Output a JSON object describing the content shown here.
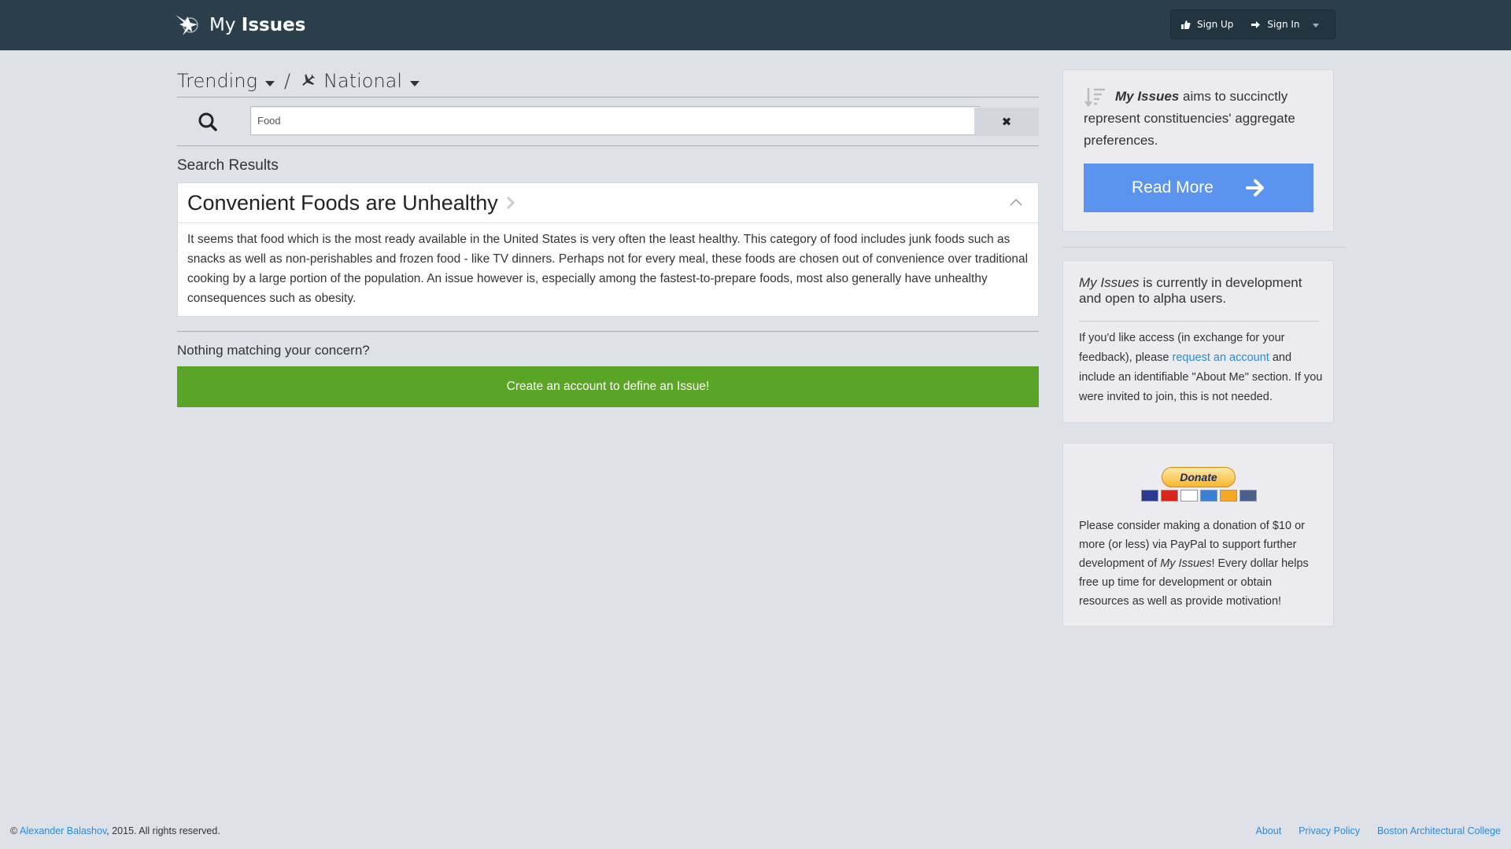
{
  "header": {
    "brand_my": "My",
    "brand_issues": "Issues",
    "sign_up": "Sign Up",
    "sign_in": "Sign In"
  },
  "breadcrumb": {
    "trending": "Trending",
    "separator": "/",
    "national": "National"
  },
  "search": {
    "value": "Food",
    "clear": "✖"
  },
  "results": {
    "label": "Search Results",
    "items": [
      {
        "title": "Convenient Foods are Unhealthy",
        "body": "It seems that food which is the most ready available in the United States is very often the least healthy. This category of food includes junk foods such as snacks as well as non-perishables and frozen food - like TV dinners. Perhaps not for every meal, these foods are chosen out of convenience over traditional cooking by a large portion of the population. An issue however is, especially among the fastest-to-prepare foods, most also generally have unhealthy consequences such as obesity."
      }
    ]
  },
  "cta": {
    "concern": "Nothing matching your concern?",
    "create": "Create an account to define an Issue!"
  },
  "sidebar": {
    "aims_brand": "My Issues",
    "aims_text": " aims to succinctly represent constituencies' aggregate preferences.",
    "read_more": "Read More",
    "dev_brand": "My Issues",
    "dev_text": " is currently in development and open to alpha users.",
    "access_pre": "If you'd like access (in exchange for your feedback), please ",
    "access_link": "request an account",
    "access_post": " and include an identifiable \"About Me\" section. If you were invited to join, this is not needed.",
    "donate": "Donate",
    "donation_pre": "Please consider making a donation of $10 or more (or less) via PayPal to support further development of ",
    "donation_brand": "My Issues",
    "donation_post": "! Every dollar helps free up time for development or obtain resources as well as provide motivation!"
  },
  "footer": {
    "copyright_symbol": "©",
    "author": "Alexander Balashov",
    "copyright_rest": ", 2015. All rights reserved.",
    "links": [
      "About",
      "Privacy Policy",
      "Boston Architectural College"
    ]
  },
  "colors": {
    "topbar": "#2b3e4c",
    "accent_blue": "#5a94ee",
    "accent_green": "#5ba526",
    "link": "#2a8bd6"
  }
}
